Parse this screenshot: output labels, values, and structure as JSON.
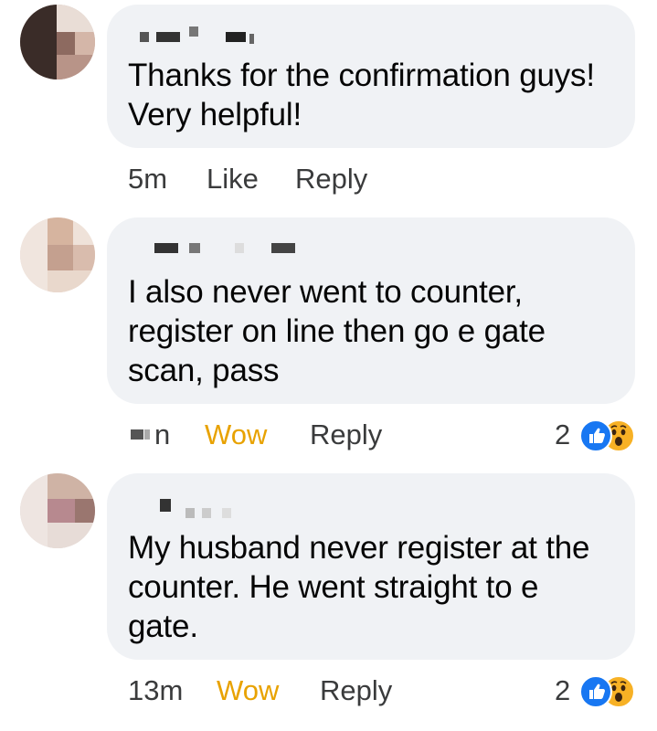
{
  "comments": [
    {
      "author": "",
      "text": "Thanks for the confirmation guys! Very helpful!",
      "time": "5m",
      "reaction_label": "Like",
      "reply_label": "Reply",
      "reaction_count": "",
      "avatar_colors": [
        "#3a2c28",
        "#d4b6a8",
        "#8d6a60",
        "#eee2dc"
      ]
    },
    {
      "author": "",
      "text": "I also never went to counter, register on line then go e gate scan, pass",
      "time": "n",
      "reaction_label": "Wow",
      "reply_label": "Reply",
      "reaction_count": "2",
      "reaction_icons": [
        "like-icon",
        "wow-icon"
      ],
      "avatar_colors": [
        "#d6b49f",
        "#e9d8cc",
        "#c4a08f",
        "#f2e8e2"
      ]
    },
    {
      "author": "",
      "text": "My husband never register at the counter. He went straight to e gate.",
      "time": "13m",
      "reaction_label": "Wow",
      "reply_label": "Reply",
      "reaction_count": "2",
      "reaction_icons": [
        "like-icon",
        "wow-icon"
      ],
      "avatar_colors": [
        "#cfb3a5",
        "#b7898f",
        "#e7dcd7",
        "#9a766f"
      ]
    }
  ],
  "colors": {
    "bubble": "#f0f2f5",
    "wow_text": "#e8a200",
    "like_blue": "#1877f2",
    "wow_yellow": "#f7b125"
  }
}
